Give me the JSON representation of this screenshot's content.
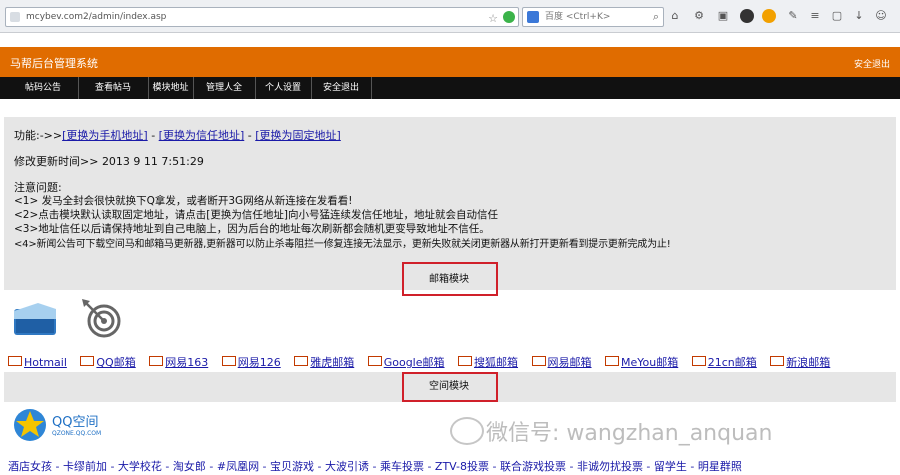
{
  "browser": {
    "url": "mcybev.com2/admin/index.asp",
    "search_placeholder": "百度 <Ctrl+K>",
    "search_engine": "baidu"
  },
  "header": {
    "title": "马帮后台管理系统",
    "logout": "安全退出"
  },
  "nav": {
    "items": [
      "帖码公告",
      "查看帖马",
      "模块地址",
      "管理人全",
      "个人设置",
      "安全退出"
    ]
  },
  "function_line": {
    "prefix": "功能:->>",
    "links": [
      "[更换为手机地址]",
      "[更换为信任地址]",
      "[更换为固定地址]"
    ],
    "separator": " - "
  },
  "update_line": {
    "label": "修改更新时间>>",
    "value": "2013 9 11 7:51:29"
  },
  "notes": {
    "heading": "注意问题:",
    "items": [
      "<1> 发马全封会很快就换下Q拿发，或者断开3G网络从新连接在发看看!",
      "<2>点击模块默认读取固定地址，请点击[更换为信任地址]向小号猛连续发信任地址，地址就会自动信任",
      "<3>地址信任以后请保持地址到自己电脑上，因为后台的地址每次刷新都会随机更变导致地址不信任。",
      "<4>新闻公告可下载空间马和邮箱马更新器,更新器可以防止杀毒阻拦一修复连接无法显示，更新失败就关闭更新器从新打开更新看到提示更新完成为止!"
    ]
  },
  "sections": {
    "mail_module": "邮箱模块",
    "space_module": "空间模块"
  },
  "mail_links": [
    "Hotmail",
    "QQ邮箱",
    "网易163",
    "网易126",
    "雅虎邮箱",
    "Google邮箱",
    "搜狐邮箱",
    "网易邮箱",
    "MeYou邮箱",
    "21cn邮箱",
    "新浪邮箱"
  ],
  "qq_space": {
    "logo_text": "QQ空间",
    "logo_sub": "QZONE.QQ.COM"
  },
  "bottom_links": "酒店女孩 - 卡缪前加 - 大学校花 - 淘女郎 - #凤凰网 - 宝贝游戏 - 大波引诱 - 乘车投票 - ZTV-8投票 - 联合游戏投票 - 非诚勿扰投票 - 留学生 - 明星群照",
  "watermark": "微信号: wangzhan_anquan",
  "colors": {
    "header": "#e06c00",
    "nav": "#111111",
    "panel": "#e6e6e6",
    "link": "#1a1aa8",
    "highlight_box": "#d0202a"
  }
}
